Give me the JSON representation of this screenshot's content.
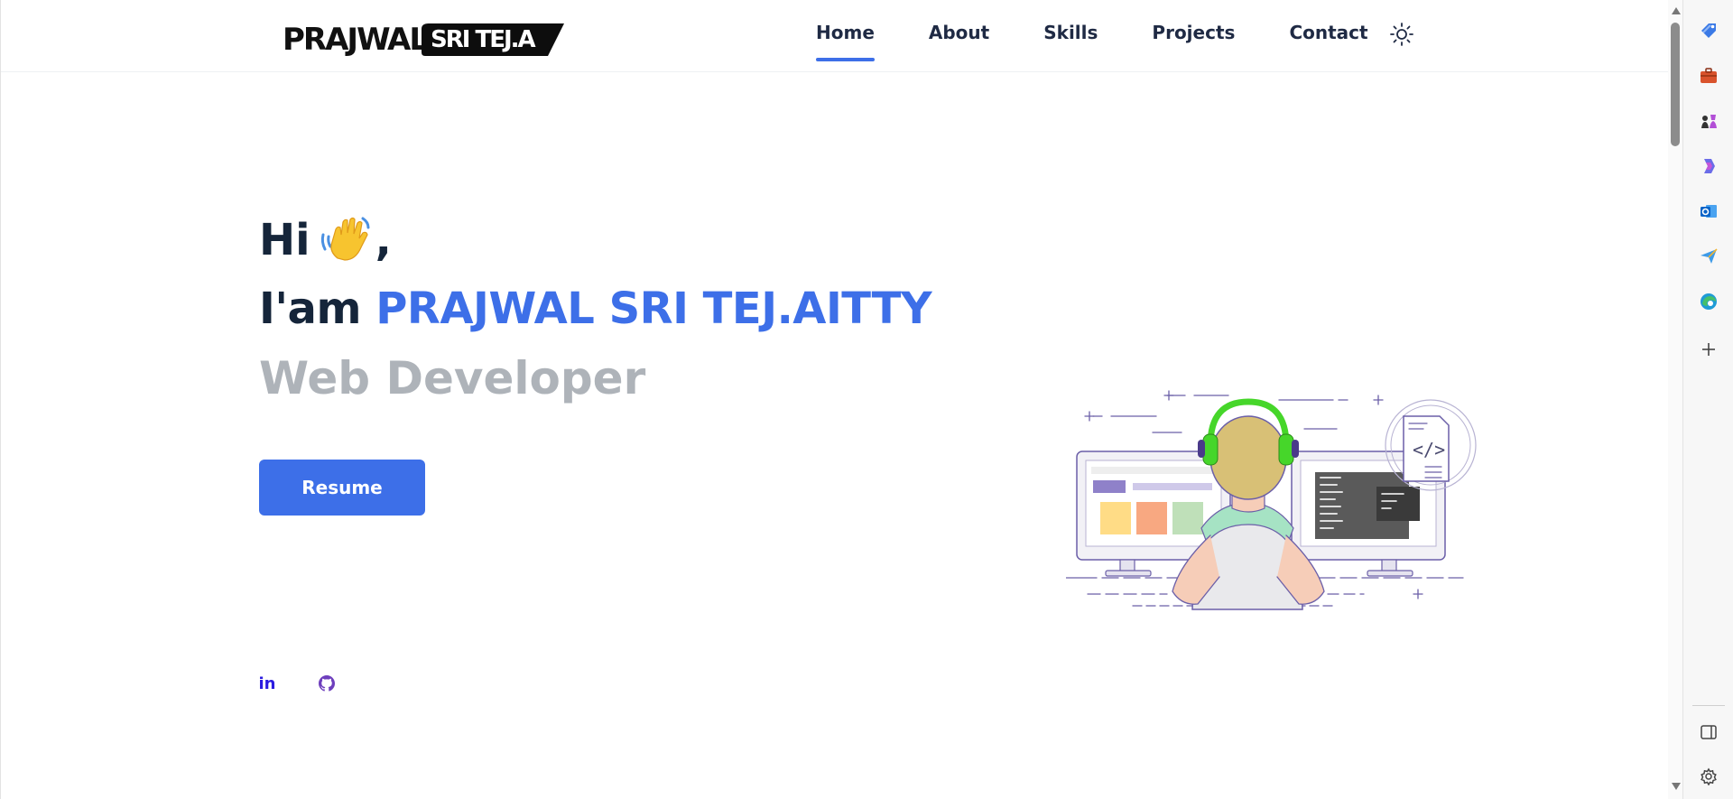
{
  "logo": {
    "main": "PRAJWAL",
    "badge": "SRI TEJ.A"
  },
  "nav": {
    "items": [
      {
        "label": "Home",
        "active": true
      },
      {
        "label": "About",
        "active": false
      },
      {
        "label": "Skills",
        "active": false
      },
      {
        "label": "Projects",
        "active": false
      },
      {
        "label": "Contact",
        "active": false
      }
    ],
    "theme_toggle_icon": "sun-icon"
  },
  "hero": {
    "greeting": "Hi",
    "greeting_emoji": "waving-hand-icon",
    "greeting_punct": ",",
    "intro": "I'am",
    "name": "PRAJWAL SRI TEJ.AITTY",
    "role": "Web Developer",
    "resume_label": "Resume"
  },
  "social": [
    {
      "label": "in",
      "icon": "linkedin-icon"
    },
    {
      "icon": "github-icon"
    }
  ],
  "colors": {
    "accent": "#3d6fe8",
    "heading": "#15253a",
    "muted": "#aeb3b9",
    "nav_text": "#1f2a44",
    "linkedin": "#2b1be0",
    "github": "#6e3fbd"
  },
  "sidebar_icons": [
    "tag-icon",
    "briefcase-icon",
    "chess-icon",
    "copilot-icon",
    "outlook-icon",
    "send-icon",
    "edge-icon",
    "add-icon",
    "sidebar-toggle-icon",
    "settings-icon"
  ]
}
